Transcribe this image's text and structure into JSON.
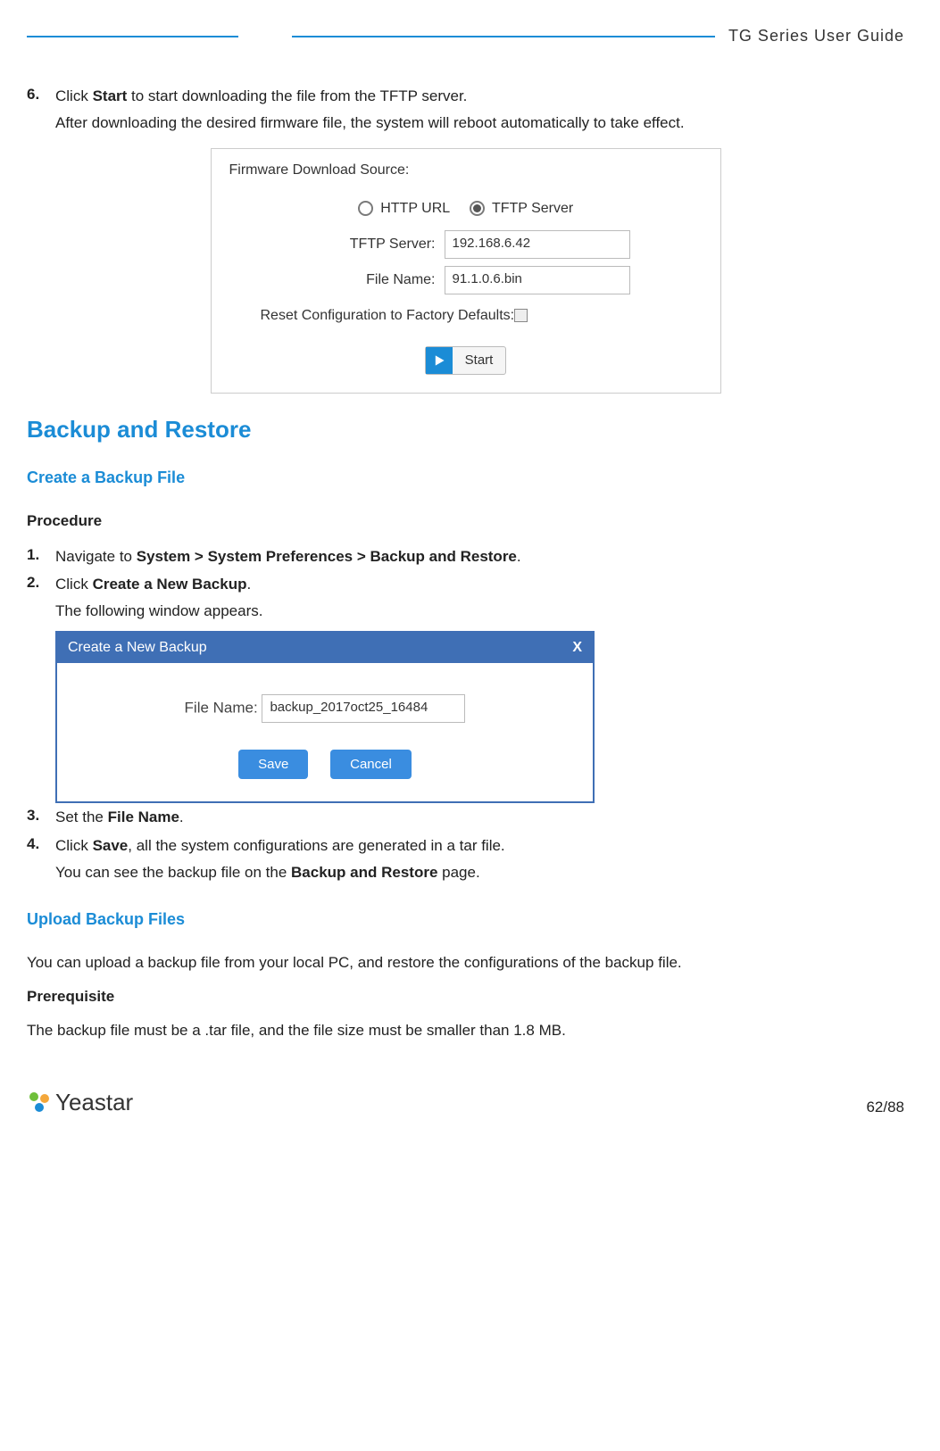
{
  "header": {
    "title": "TG Series User Guide"
  },
  "step6": {
    "num": "6.",
    "line1_a": "Click ",
    "line1_b": "Start",
    "line1_c": " to start downloading the file from the TFTP server.",
    "line2": "After downloading the desired firmware file, the system will reboot automatically to take effect."
  },
  "shot1": {
    "heading": "Firmware Download Source:",
    "opt_http": "HTTP URL",
    "opt_tftp": "TFTP Server",
    "lbl_tftp": "TFTP Server:",
    "val_tftp": "192.168.6.42",
    "lbl_file": "File Name:",
    "val_file": "91.1.0.6.bin",
    "lbl_reset": "Reset Configuration to Factory Defaults:",
    "btn_start": "Start"
  },
  "h_backup": "Backup and Restore",
  "h_create": "Create a Backup File",
  "h_proc": "Procedure",
  "s1": {
    "num": "1.",
    "a": "Navigate to ",
    "b": "System > System Preferences > Backup and Restore",
    "c": "."
  },
  "s2": {
    "num": "2.",
    "a": "Click ",
    "b": "Create a New Backup",
    "c": ".",
    "d": "The following window appears."
  },
  "shot2": {
    "title": "Create a New Backup",
    "close": "X",
    "lbl_file": "File Name:",
    "val_file": "backup_2017oct25_16484",
    "btn_save": "Save",
    "btn_cancel": "Cancel"
  },
  "s3": {
    "num": "3.",
    "a": "Set the ",
    "b": "File Name",
    "c": "."
  },
  "s4": {
    "num": "4.",
    "a": "Click ",
    "b": "Save",
    "c": ", all the system configurations are generated in a tar file.",
    "d_a": "You can see the backup file on the ",
    "d_b": "Backup and Restore",
    "d_c": " page."
  },
  "h_upload": "Upload Backup Files",
  "p_upload": "You can upload a backup file from your local PC, and restore the configurations of the backup file.",
  "h_prereq": "Prerequisite",
  "p_prereq": "The backup file must be a .tar file, and the file size must be smaller than 1.8 MB.",
  "footer": {
    "brand": "Yeastar",
    "page": "62/88"
  }
}
